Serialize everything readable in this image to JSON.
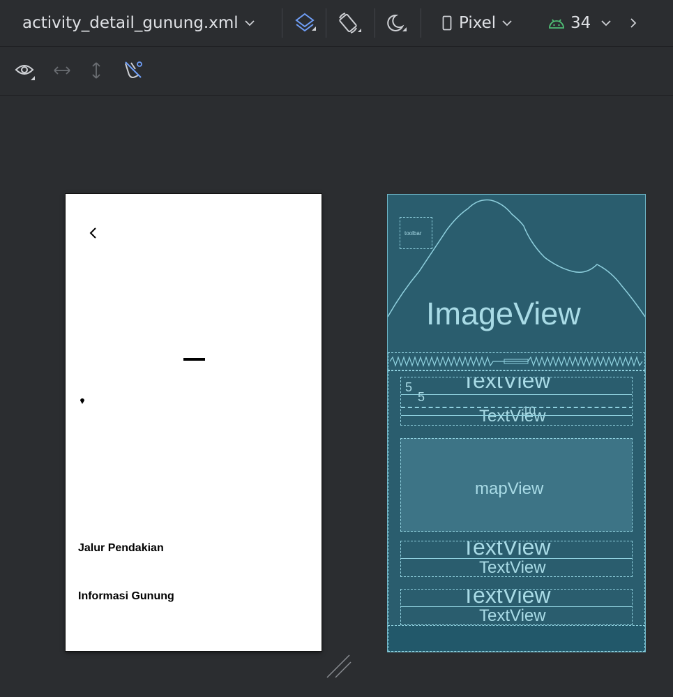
{
  "toolbar": {
    "file_name": "activity_detail_gunung.xml",
    "device_label": "Pixel",
    "api_level": "34"
  },
  "preview": {
    "jalur_label": "Jalur Pendakian",
    "info_label": "Informasi Gunung"
  },
  "blueprint": {
    "toolbar_label": "toolbar",
    "image_label": "ImageView",
    "textview_label": "TextView",
    "map_label": "mapView",
    "num_5": "5",
    "num_10": "10"
  },
  "colors": {
    "android_green": "#4fbf76",
    "layers_blue": "#6f9ef7",
    "blueprint_bg": "#2a5d6e",
    "blueprint_line": "#8fd0de"
  }
}
